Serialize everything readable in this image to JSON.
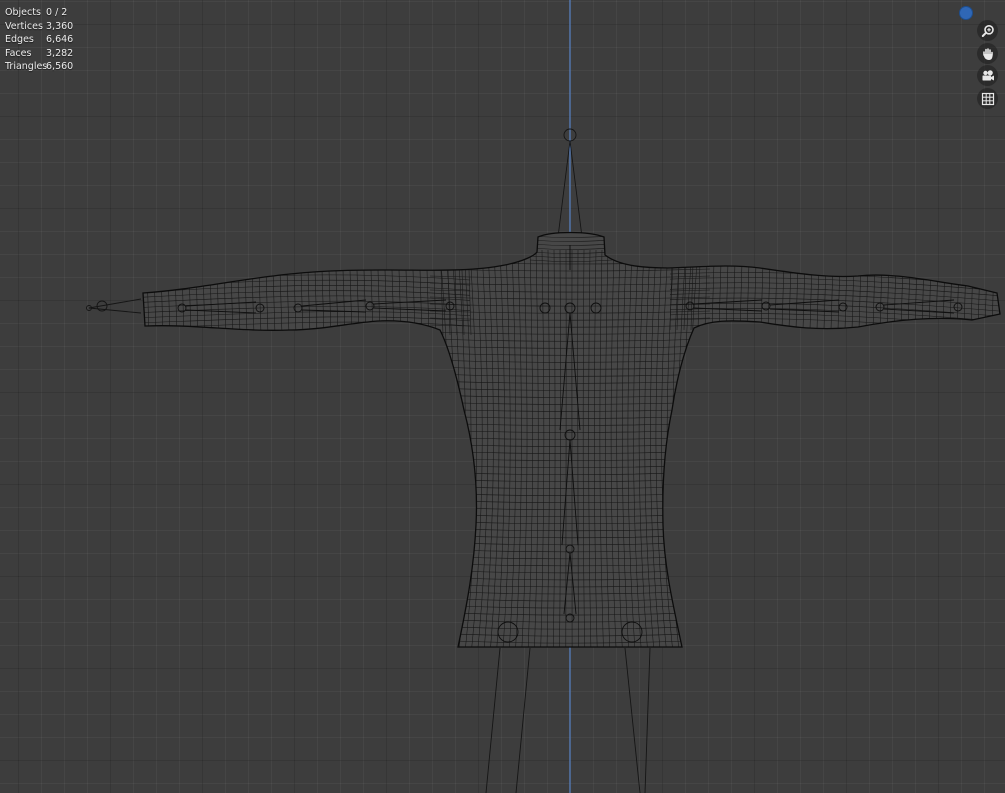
{
  "statistics": [
    {
      "label": "Objects",
      "value": "0 / 2"
    },
    {
      "label": "Vertices",
      "value": "3,360"
    },
    {
      "label": "Edges",
      "value": "6,646"
    },
    {
      "label": "Faces",
      "value": "3,282"
    },
    {
      "label": "Triangles",
      "value": "6,560"
    }
  ],
  "navigation": {
    "gizmo_axis_color": "#2f67b6",
    "buttons": [
      {
        "name": "zoom-icon"
      },
      {
        "name": "pan-hand-icon"
      },
      {
        "name": "camera-view-icon"
      },
      {
        "name": "orthographic-grid-icon"
      }
    ]
  },
  "viewport": {
    "background_color": "#3d3d3d",
    "z_axis_color": "#5b86c9",
    "mesh_wire_color": "#111111",
    "armature_color": "#151515",
    "shading_mode": "wireframe"
  }
}
